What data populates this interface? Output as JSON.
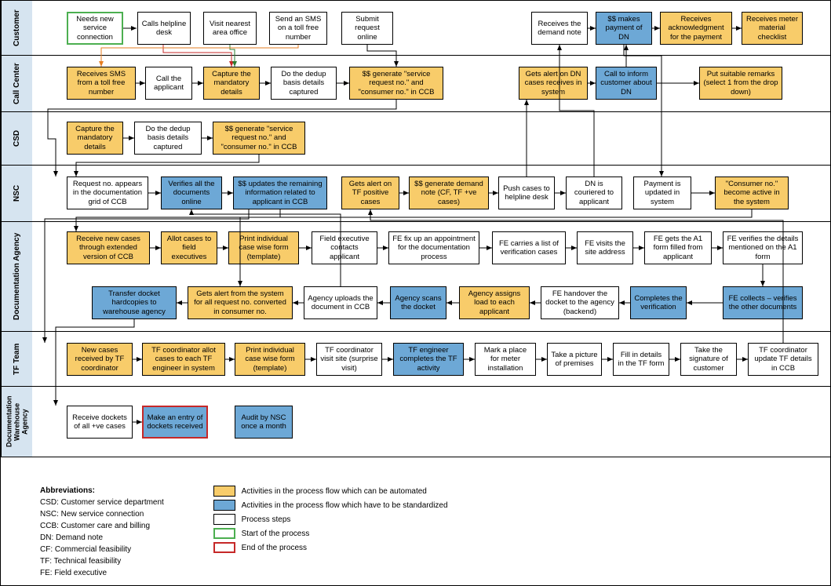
{
  "lanes": {
    "customer": "Customer",
    "callcenter": "Call Center",
    "csd": "CSD",
    "nsc": "NSC",
    "docagency": "Documentation Agency",
    "tfteam": "TF Team",
    "warehouse": "Documentation Warehouse Agency"
  },
  "boxes": {
    "cust1": "Needs new service connection",
    "cust2": "Calls helpline desk",
    "cust3": "Visit nearest area office",
    "cust4": "Send an SMS on a toll free number",
    "cust5": "Submit request online",
    "cust6": "Receives the demand note",
    "cust7": "$$ makes payment of DN",
    "cust8": "Receives acknowledgment for the payment",
    "cust9": "Receives meter material checklist",
    "cc1": "Receives SMS from a toll free number",
    "cc2": "Call the applicant",
    "cc3": "Capture the mandatory details",
    "cc4": "Do the dedup basis details captured",
    "cc5": "$$ generate \"service request no.\" and \"consumer no.\" in CCB",
    "cc6": "Gets alert on DN cases receives in system",
    "cc7": "Call to inform customer about DN",
    "cc8": "Put suitable remarks (select 1 from the drop down)",
    "csd1": "Capture the mandatory details",
    "csd2": "Do the dedup basis details captured",
    "csd3": "$$ generate \"service request no.\" and \"consumer no.\" in CCB",
    "nsc1": "Request no. appears in the documentation grid of CCB",
    "nsc2": "Verifies all the documents online",
    "nsc3": "$$ updates the remaining information related to applicant in CCB",
    "nsc4": "Gets alert on TF positive cases",
    "nsc5": "$$ generate demand note (CF, TF +ve cases)",
    "nsc6": "Push cases to helpline desk",
    "nsc7": "DN is couriered to applicant",
    "nsc8": "Payment is updated in system",
    "nsc9": "\"Consumer no.\" become active in the system",
    "da1": "Receive new cases through extended version of CCB",
    "da2": "Allot cases to field executives",
    "da3": "Print individual case wise form (template)",
    "da4": "Field executive contacts applicant",
    "da5": "FE fix up an appointment for the documentation process",
    "da6": "FE carries a list of verification cases",
    "da7": "FE visits the site address",
    "da8": "FE gets the A1 form filled from applicant",
    "da9": "FE verifies the details mentioned on the A1 form",
    "da10": "Transfer docket hardcopies to warehouse agency",
    "da11": "Gets alert from the system for all request no. converted in consumer no.",
    "da12": "Agency uploads the document in CCB",
    "da13": "Agency scans the docket",
    "da14": "Agency assigns load to each applicant",
    "da15": "FE handover the docket to the agency (backend)",
    "da16": "Completes the verification",
    "da17": "FE collects – verifies the other documents",
    "tf1": "New cases received by TF coordinator",
    "tf2": "TF coordinator allot cases to each TF engineer in system",
    "tf3": "Print individual case wise form (template)",
    "tf4": "TF coordinator visit site (surprise visit)",
    "tf5": "TF engineer completes the TF activity",
    "tf6": "Mark a place for meter installation",
    "tf7": "Take a picture of premises",
    "tf8": "Fill in details in the TF form",
    "tf9": "Take the signature of customer",
    "tf10": "TF coordinator update TF details in CCB",
    "wh1": "Receive dockets of all +ve cases",
    "wh2": "Make an entry of dockets received",
    "wh3": "Audit by NSC once a month"
  },
  "abbreviations": {
    "title": "Abbreviations:",
    "csd": "CSD: Customer service department",
    "nsc": "NSC: New service connection",
    "ccb": "CCB: Customer care and billing",
    "dn": "DN: Demand note",
    "cf": "CF: Commercial feasibility",
    "tf": "TF: Technical feasibility",
    "fe": "FE: Field executive"
  },
  "legend": {
    "automate": "Activities in the process flow which can be automated",
    "standard": "Activities in the process flow which have to be standardized",
    "steps": "Process steps",
    "start": "Start of the process",
    "end": "End of the process"
  }
}
